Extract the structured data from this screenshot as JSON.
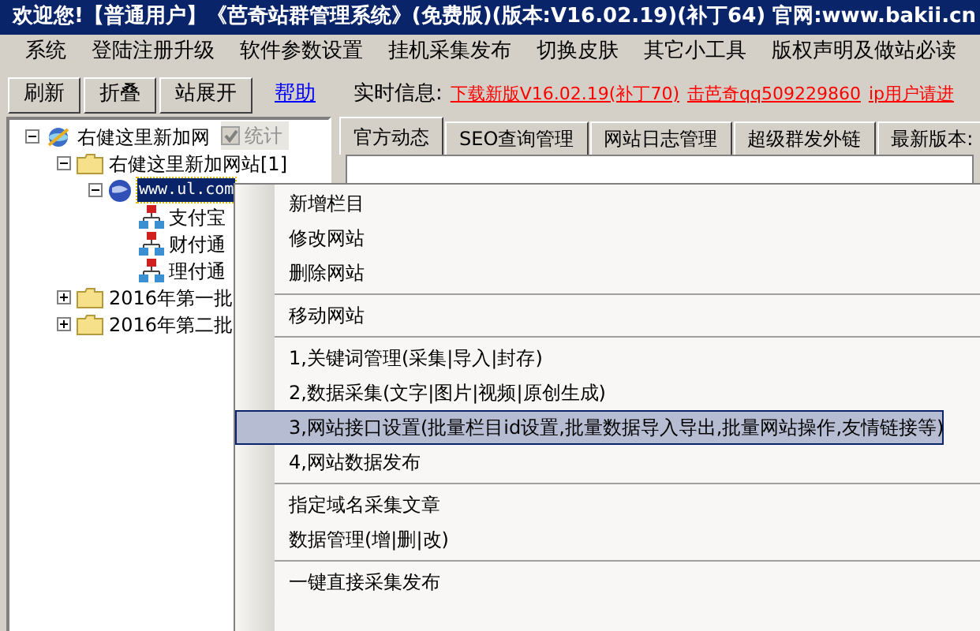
{
  "window": {
    "title": "欢迎您!【普通用户】《芭奇站群管理系统》(免费版)(版本:V16.02.19)(补丁64) 官网:www.bakii.cn"
  },
  "menu_bar": [
    "系统",
    "登陆注册升级",
    "软件参数设置",
    "挂机采集发布",
    "切换皮肤",
    "其它小工具",
    "版权声明及做站必读"
  ],
  "toolbar": {
    "buttons": [
      "刷新",
      "折叠",
      "站展开"
    ],
    "help_link": "帮助",
    "info_label": "实时信息:",
    "news_links": [
      "下载新版V16.02.19(补丁70)",
      "击芭奇qq509229860",
      "ip用户请进"
    ]
  },
  "stats_checkbox": {
    "label": "统计",
    "checked": true
  },
  "tree": [
    {
      "label": "右健这里新加网",
      "kind": "root",
      "expanded": true,
      "selected": false,
      "children": [
        {
          "label": "右健这里新加网站[1]",
          "kind": "folder",
          "expanded": true,
          "selected": false,
          "children": [
            {
              "label": "www.ul.com",
              "kind": "site",
              "expanded": true,
              "selected": true,
              "children": [
                {
                  "label": "支付宝",
                  "kind": "column",
                  "selected": false
                },
                {
                  "label": "财付通",
                  "kind": "column",
                  "selected": false
                },
                {
                  "label": "理付通",
                  "kind": "column",
                  "selected": false
                }
              ]
            }
          ]
        },
        {
          "label": "2016年第一批",
          "kind": "folder",
          "expanded": false,
          "selected": false
        },
        {
          "label": "2016年第二批",
          "kind": "folder",
          "expanded": false,
          "selected": false
        }
      ]
    }
  ],
  "tabs": [
    {
      "label": "官方动态",
      "selected": true
    },
    {
      "label": "SEO查询管理",
      "selected": false
    },
    {
      "label": "网站日志管理",
      "selected": false
    },
    {
      "label": "超级群发外链",
      "selected": false
    },
    {
      "label": "最新版本:",
      "selected": false
    }
  ],
  "context_menu": [
    [
      {
        "label": "新增栏目",
        "selected": false
      },
      {
        "label": "修改网站",
        "selected": false
      },
      {
        "label": "删除网站",
        "selected": false
      }
    ],
    [
      {
        "label": "移动网站",
        "selected": false
      }
    ],
    [
      {
        "label": "1,关键词管理(采集|导入|封存)",
        "selected": false
      },
      {
        "label": "2,数据采集(文字|图片|视频|原创生成)",
        "selected": false
      },
      {
        "label": "3,网站接口设置(批量栏目id设置,批量数据导入导出,批量网站操作,友情链接等)",
        "selected": true
      },
      {
        "label": "4,网站数据发布",
        "selected": false
      }
    ],
    [
      {
        "label": "指定域名采集文章",
        "selected": false
      },
      {
        "label": "数据管理(增|删|改)",
        "selected": false
      }
    ],
    [
      {
        "label": "一键直接采集发布",
        "selected": false
      }
    ]
  ]
}
